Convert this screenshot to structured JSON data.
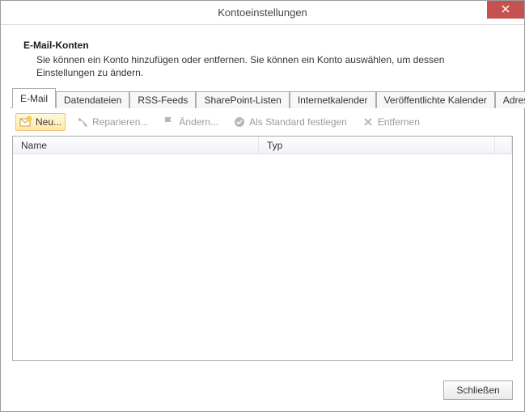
{
  "window": {
    "title": "Kontoeinstellungen"
  },
  "header": {
    "heading": "E-Mail-Konten",
    "subtext": "Sie können ein Konto hinzufügen oder entfernen. Sie können ein Konto auswählen, um dessen Einstellungen zu ändern."
  },
  "tabs": [
    {
      "label": "E-Mail",
      "active": true
    },
    {
      "label": "Datendateien"
    },
    {
      "label": "RSS-Feeds"
    },
    {
      "label": "SharePoint-Listen"
    },
    {
      "label": "Internetkalender"
    },
    {
      "label": "Veröffentlichte Kalender"
    },
    {
      "label": "Adressbücher"
    }
  ],
  "toolbar": {
    "new_label": "Neu...",
    "repair_label": "Reparieren...",
    "change_label": "Ändern...",
    "default_label": "Als Standard festlegen",
    "remove_label": "Entfernen"
  },
  "columns": {
    "name": "Name",
    "type": "Typ"
  },
  "footer": {
    "close_label": "Schließen"
  }
}
